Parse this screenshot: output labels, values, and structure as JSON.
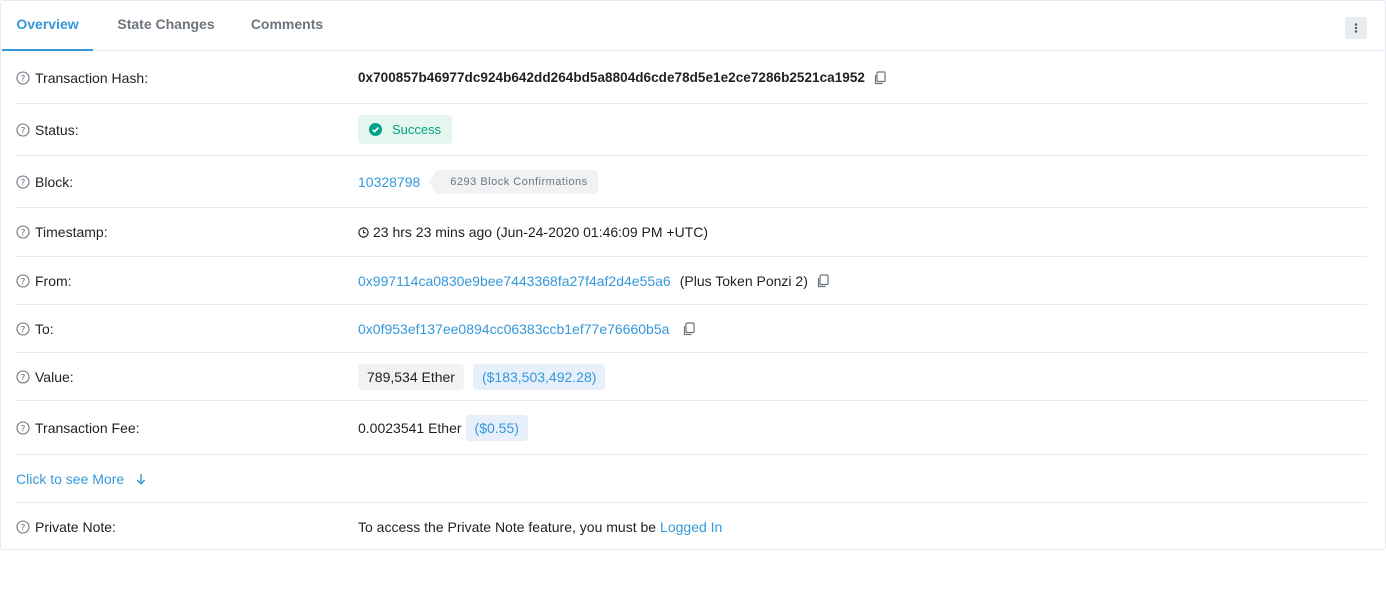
{
  "tabs": [
    {
      "label": "Overview",
      "active": true
    },
    {
      "label": "State Changes",
      "active": false
    },
    {
      "label": "Comments",
      "active": false
    }
  ],
  "tx": {
    "hash_label": "Transaction Hash:",
    "hash_value": "0x700857b46977dc924b642dd264bd5a8804d6cde78d5e1e2ce7286b2521ca1952",
    "status_label": "Status:",
    "status_value": "Success",
    "block_label": "Block:",
    "block_value": "10328798",
    "block_confirmations": "6293 Block Confirmations",
    "timestamp_label": "Timestamp:",
    "timestamp_value": "23 hrs 23 mins ago (Jun-24-2020 01:46:09 PM +UTC)",
    "from_label": "From:",
    "from_address": "0x997114ca0830e9bee7443368fa27f4af2d4e55a6",
    "from_name": "(Plus Token Ponzi 2)",
    "to_label": "To:",
    "to_address": "0x0f953ef137ee0894cc06383ccb1ef77e76660b5a",
    "value_label": "Value:",
    "value_ether": "789,534 Ether",
    "value_usd": "($183,503,492.28)",
    "fee_label": "Transaction Fee:",
    "fee_ether": "0.0023541 Ether",
    "fee_usd": "($0.55)",
    "see_more": "Click to see More",
    "note_label": "Private Note:",
    "note_text": "To access the Private Note feature, you must be",
    "note_link": "Logged In"
  },
  "colors": {
    "accent": "#3498db",
    "success": "#00a186",
    "border": "#e7eaf3"
  },
  "icons": [
    "question-icon",
    "copy-icon",
    "check-circle-icon",
    "clock-icon",
    "arrow-down-icon",
    "more-vertical-icon"
  ]
}
